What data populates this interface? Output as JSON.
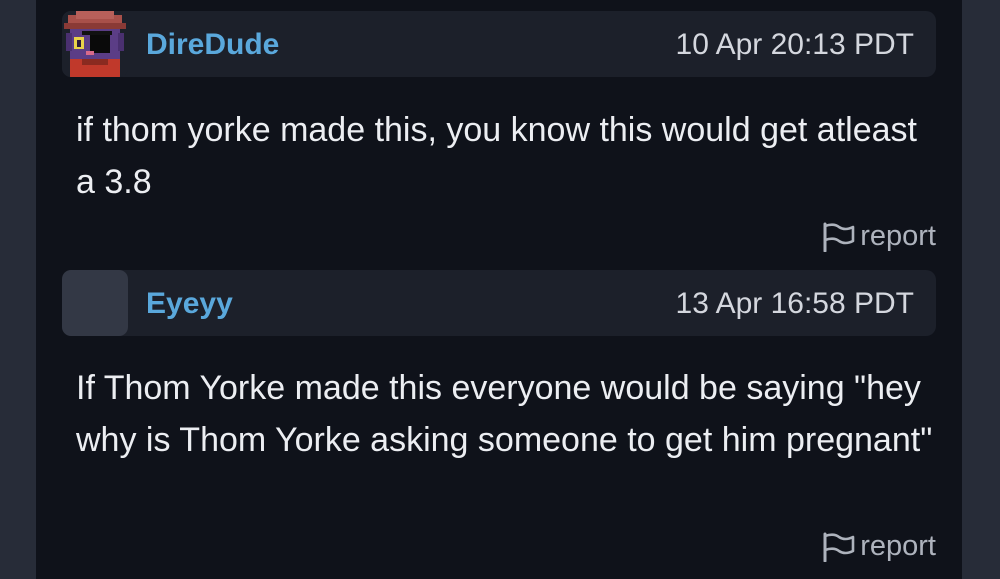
{
  "comments": [
    {
      "username": "DireDude",
      "timestamp": "10 Apr 20:13 PDT",
      "avatar": "pixel-art-cat-avatar",
      "body": "if thom yorke made this, you know this would get atleast a 3.8",
      "report_label": "report"
    },
    {
      "username": "Eyeyy",
      "timestamp": "13 Apr 16:58 PDT",
      "avatar": "blank-avatar",
      "body": "If Thom Yorke made this everyone would be saying \"hey why is Thom Yorke asking someone to get him pregnant\"",
      "report_label": "report"
    }
  ],
  "colors": {
    "background": "#0f121a",
    "header": "#1c202a",
    "username": "#5aa8dc",
    "text": "#eceef2",
    "muted": "#aeb3bd"
  }
}
